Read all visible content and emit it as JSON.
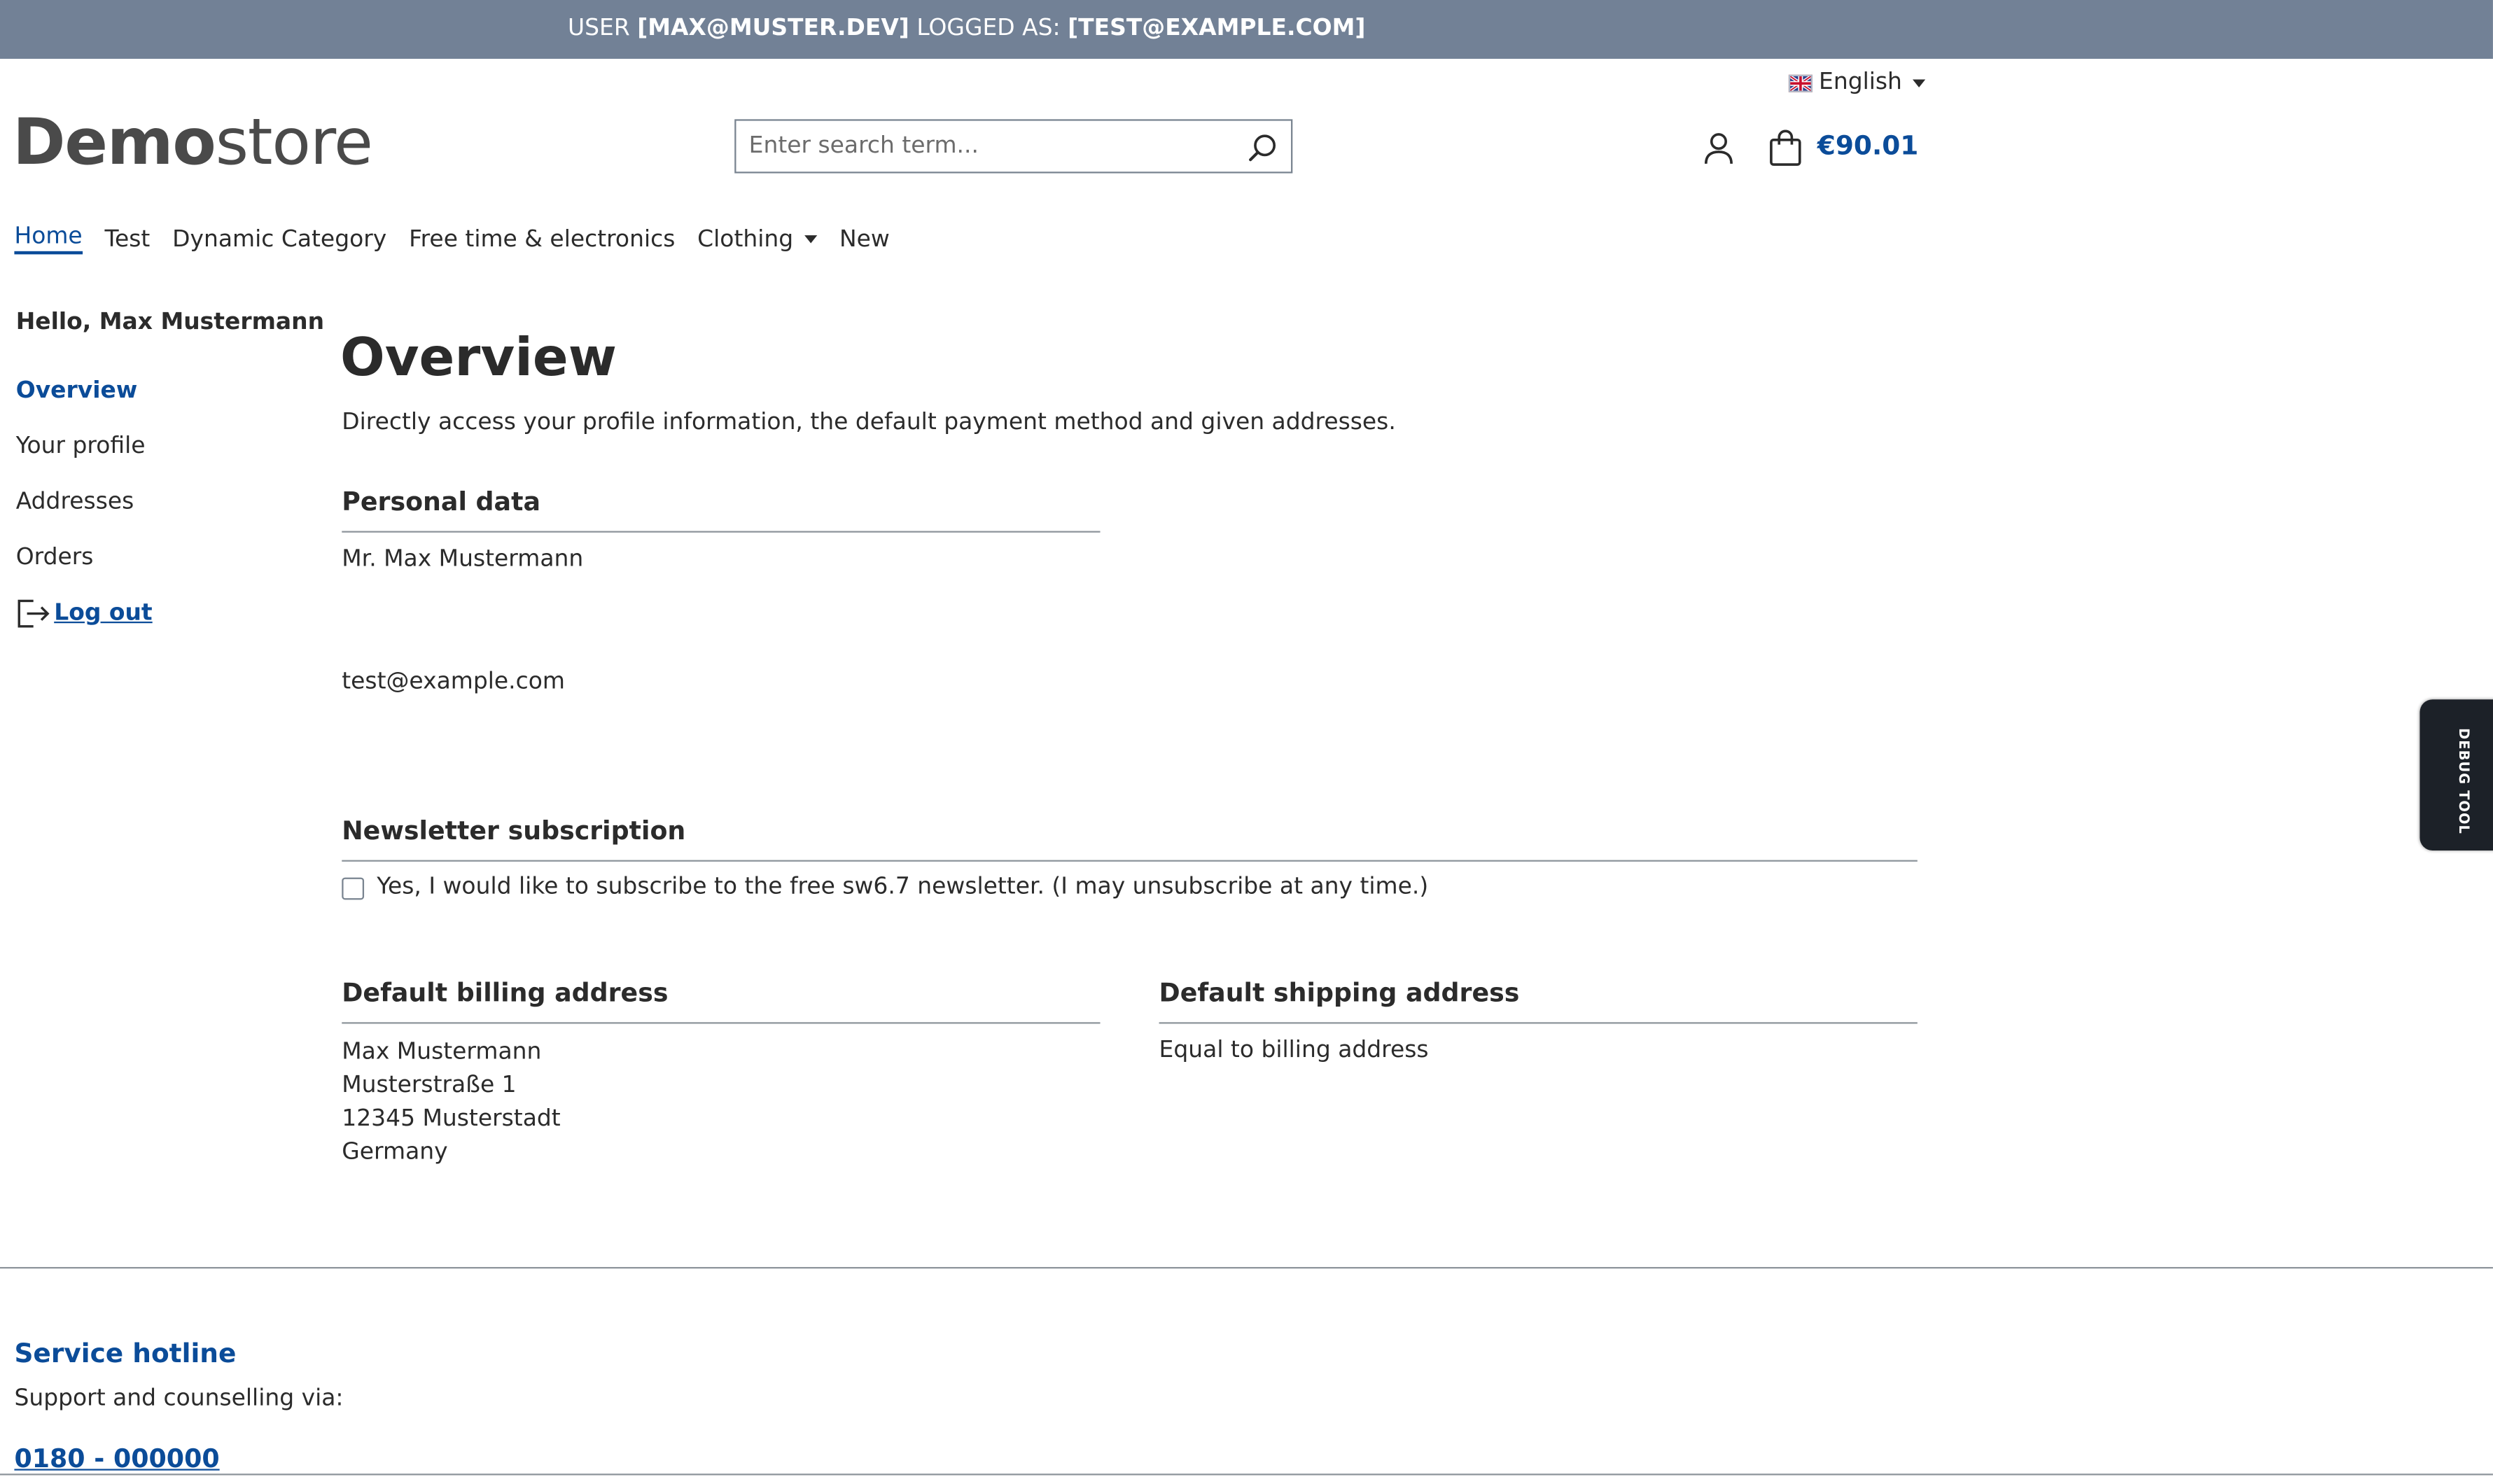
{
  "topbar": {
    "user_prefix": "USER ",
    "user_email": "[MAX@MUSTER.DEV]",
    "logged_as_prefix": " LOGGED AS: ",
    "logged_as_email": "[TEST@EXAMPLE.COM]"
  },
  "language": {
    "selected": "English",
    "icon": "uk-flag-icon"
  },
  "logo": {
    "bold": "Demo",
    "light": "store"
  },
  "search": {
    "placeholder": "Enter search term...",
    "value": ""
  },
  "header": {
    "cart_total": "€90.01"
  },
  "nav": {
    "items": [
      {
        "label": "Home"
      },
      {
        "label": "Test"
      },
      {
        "label": "Dynamic Category"
      },
      {
        "label": "Free time & electronics"
      },
      {
        "label": "Clothing"
      },
      {
        "label": "New"
      }
    ]
  },
  "sidebar": {
    "greeting": "Hello, Max Mustermann",
    "items": [
      {
        "label": "Overview"
      },
      {
        "label": "Your profile"
      },
      {
        "label": "Addresses"
      },
      {
        "label": "Orders"
      }
    ],
    "logout": "Log out"
  },
  "main": {
    "title": "Overview",
    "lead": "Directly access your profile information, the default payment method and given addresses.",
    "personal": {
      "title": "Personal data",
      "name": "Mr. Max Mustermann",
      "email": "test@example.com"
    },
    "newsletter": {
      "title": "Newsletter subscription",
      "label": "Yes, I would like to subscribe to the free sw6.7 newsletter. (I may unsubscribe at any time.)",
      "checked": false
    },
    "billing": {
      "title": "Default billing address",
      "lines": [
        "Max Mustermann",
        "Musterstraße 1",
        "12345 Musterstadt",
        "Germany"
      ]
    },
    "shipping": {
      "title": "Default shipping address",
      "text": "Equal to billing address"
    }
  },
  "footer": {
    "hotline_title": "Service hotline",
    "hotline_text": "Support and counselling via:",
    "hotline_phone": "0180 - 000000"
  },
  "debug": {
    "label": "DEBUG TOOL"
  },
  "colors": {
    "accent": "#0b4c99",
    "topbar": "#728196",
    "text": "#2b2b2b"
  }
}
